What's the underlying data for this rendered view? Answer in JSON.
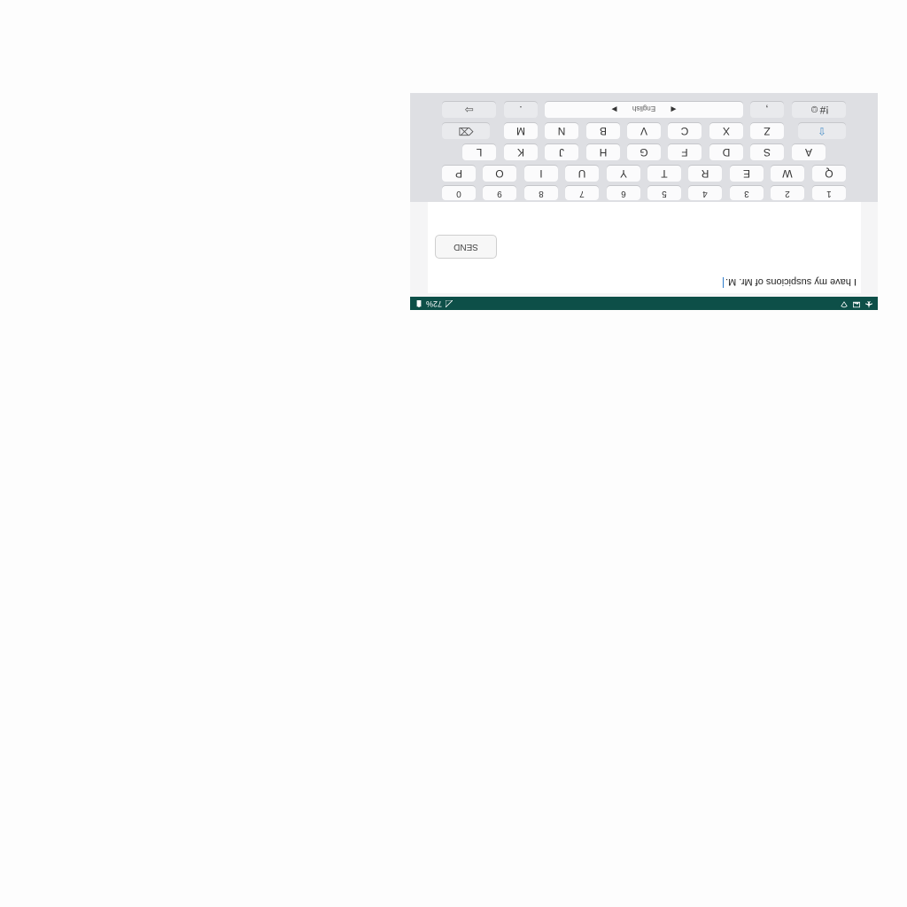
{
  "status_bar": {
    "battery_percent": "72%",
    "icons": [
      "battery-icon",
      "signal-icon",
      "wifi-icon",
      "photo-icon",
      "airplane-icon"
    ]
  },
  "compose": {
    "message": "I have my suspicions of Mr. M.",
    "send_label": "SEND"
  },
  "keyboard": {
    "number_row": [
      "1",
      "2",
      "3",
      "4",
      "5",
      "6",
      "7",
      "8",
      "9",
      "0"
    ],
    "row1": [
      "Q",
      "W",
      "E",
      "R",
      "T",
      "Y",
      "U",
      "I",
      "O",
      "P"
    ],
    "row2": [
      "A",
      "S",
      "D",
      "F",
      "G",
      "H",
      "J",
      "K",
      "L"
    ],
    "row3": [
      "Z",
      "X",
      "C",
      "V",
      "B",
      "N",
      "M"
    ],
    "symbols_label": "!#☺",
    "comma_label": ",",
    "space_label": "English",
    "period_label": ".",
    "enter_icon": "enter-icon",
    "shift_icon": "shift-icon",
    "backspace_icon": "backspace-icon"
  },
  "colors": {
    "status_bar": "#0d4f48",
    "keyboard_bg": "#dedfe3",
    "cursor": "#2f7ccc",
    "shift_accent": "#4a90c8"
  }
}
